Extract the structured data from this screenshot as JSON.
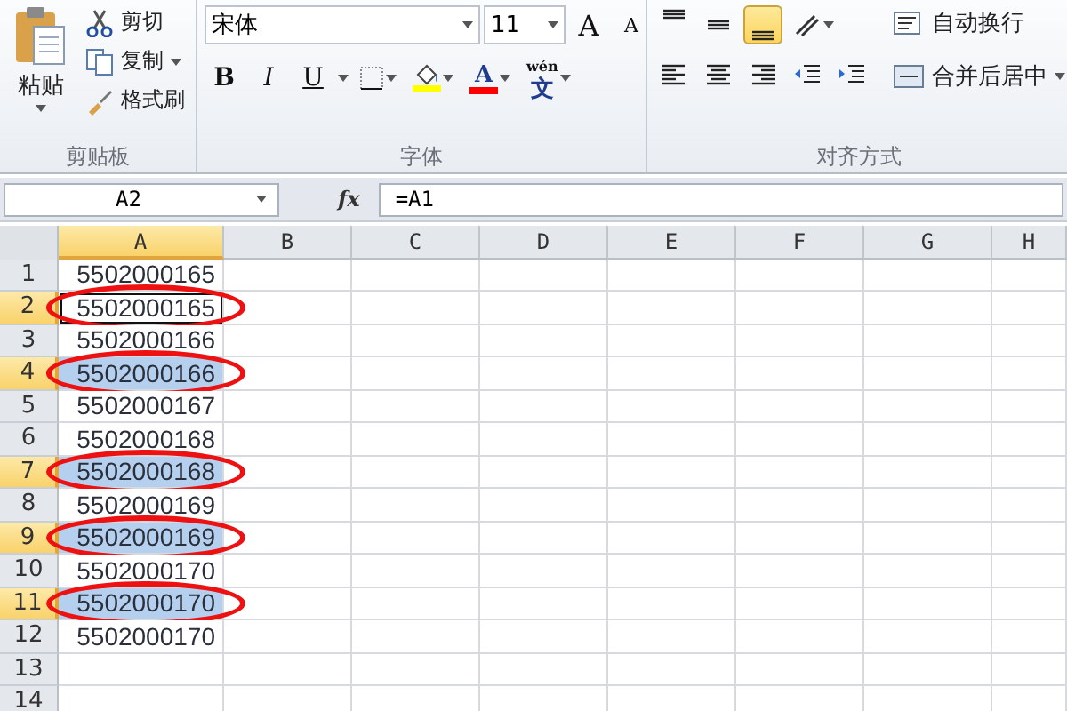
{
  "ribbon": {
    "clipboard": {
      "paste": "粘贴",
      "cut": "剪切",
      "copy": "复制",
      "format_painter": "格式刷",
      "label": "剪贴板"
    },
    "font": {
      "font_name": "宋体",
      "font_size": "11",
      "grow": "A",
      "shrink": "A",
      "styles": [
        {
          "kind": "bold",
          "label": "B"
        },
        {
          "kind": "italic",
          "label": "I"
        },
        {
          "kind": "underline",
          "label": "U"
        }
      ],
      "colors": [
        {
          "kind": "fill",
          "color": "#ffff00"
        },
        {
          "kind": "text",
          "label": "A",
          "color": "#ff0000"
        }
      ],
      "phonetic": {
        "top": "wén",
        "bottom": "文"
      },
      "label": "字体"
    },
    "alignment": {
      "top_row": [
        {
          "kind": "top",
          "selected": false
        },
        {
          "kind": "middle",
          "selected": false
        },
        {
          "kind": "bottom",
          "selected": true
        }
      ],
      "bottom_row": [
        {
          "kind": "left",
          "selected": false
        },
        {
          "kind": "center",
          "selected": false
        },
        {
          "kind": "right",
          "selected": false
        }
      ],
      "wrap_text": "自动换行",
      "merge_center": "合并后居中",
      "label": "对齐方式"
    }
  },
  "formula_bar": {
    "name_box": "A2",
    "fx": "fx",
    "formula": "=A1"
  },
  "columns": [
    {
      "label": "A",
      "selected": true
    },
    {
      "label": "B",
      "selected": false
    },
    {
      "label": "C",
      "selected": false
    },
    {
      "label": "D",
      "selected": false
    },
    {
      "label": "E",
      "selected": false
    },
    {
      "label": "F",
      "selected": false
    },
    {
      "label": "G",
      "selected": false
    },
    {
      "label": "H",
      "selected": false
    }
  ],
  "rows": [
    {
      "num": "1",
      "value": "5502000165",
      "selected": false,
      "active": false,
      "circled": false
    },
    {
      "num": "2",
      "value": "5502000165",
      "selected": true,
      "active": true,
      "circled": true
    },
    {
      "num": "3",
      "value": "5502000166",
      "selected": false,
      "active": false,
      "circled": false
    },
    {
      "num": "4",
      "value": "5502000166",
      "selected": true,
      "active": false,
      "circled": true
    },
    {
      "num": "5",
      "value": "5502000167",
      "selected": false,
      "active": false,
      "circled": false
    },
    {
      "num": "6",
      "value": "5502000168",
      "selected": false,
      "active": false,
      "circled": false
    },
    {
      "num": "7",
      "value": "5502000168",
      "selected": true,
      "active": false,
      "circled": true
    },
    {
      "num": "8",
      "value": "5502000169",
      "selected": false,
      "active": false,
      "circled": false
    },
    {
      "num": "9",
      "value": "5502000169",
      "selected": true,
      "active": false,
      "circled": true
    },
    {
      "num": "10",
      "value": "5502000170",
      "selected": false,
      "active": false,
      "circled": false
    },
    {
      "num": "11",
      "value": "5502000170",
      "selected": true,
      "active": false,
      "circled": true
    },
    {
      "num": "12",
      "value": "5502000170",
      "selected": false,
      "active": false,
      "circled": false
    },
    {
      "num": "13",
      "selected": false,
      "active": false,
      "circled": false
    },
    {
      "num": "14",
      "selected": false,
      "active": false,
      "circled": false
    }
  ]
}
